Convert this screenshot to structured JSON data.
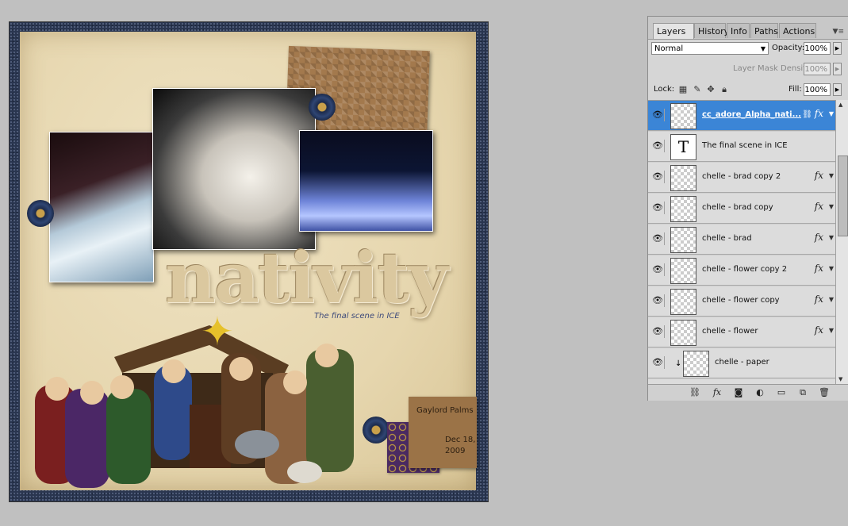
{
  "canvas": {
    "title_art": "nativity",
    "subtitle": "The final scene in ICE",
    "tag_line1": "Gaylord Palms",
    "tag_line2": "Dec 18,",
    "tag_line3": "2009"
  },
  "panel": {
    "tabs": [
      {
        "label": "Layers",
        "close": "×",
        "active": true
      },
      {
        "label": "History",
        "active": false
      },
      {
        "label": "Info",
        "active": false
      },
      {
        "label": "Paths",
        "active": false
      },
      {
        "label": "Actions",
        "active": false
      }
    ],
    "blend_mode": "Normal",
    "opacity_label": "Opacity:",
    "opacity_value": "100%",
    "mask_density_label": "Layer Mask Density",
    "mask_density_value": "100%",
    "lock_label": "Lock:",
    "fill_label": "Fill:",
    "fill_value": "100%",
    "layers": [
      {
        "name": "cc_adore_Alpha_nati...",
        "selected": true,
        "fx": "fx",
        "linked": true
      },
      {
        "name": "The final scene in ICE",
        "type": "text",
        "thumb": "T"
      },
      {
        "name": "chelle - brad copy 2",
        "fx": "fx"
      },
      {
        "name": "chelle - brad copy",
        "fx": "fx"
      },
      {
        "name": "chelle - brad",
        "fx": "fx"
      },
      {
        "name": "chelle - flower copy 2",
        "fx": "fx"
      },
      {
        "name": "chelle - flower copy",
        "fx": "fx"
      },
      {
        "name": "chelle - flower",
        "fx": "fx"
      },
      {
        "name": "chelle - paper",
        "clipped": true
      }
    ],
    "footer_icons": [
      "link-layers-icon",
      "add-style-icon",
      "add-mask-icon",
      "adjustment-layer-icon",
      "new-group-icon",
      "new-layer-icon",
      "delete-layer-icon"
    ]
  }
}
